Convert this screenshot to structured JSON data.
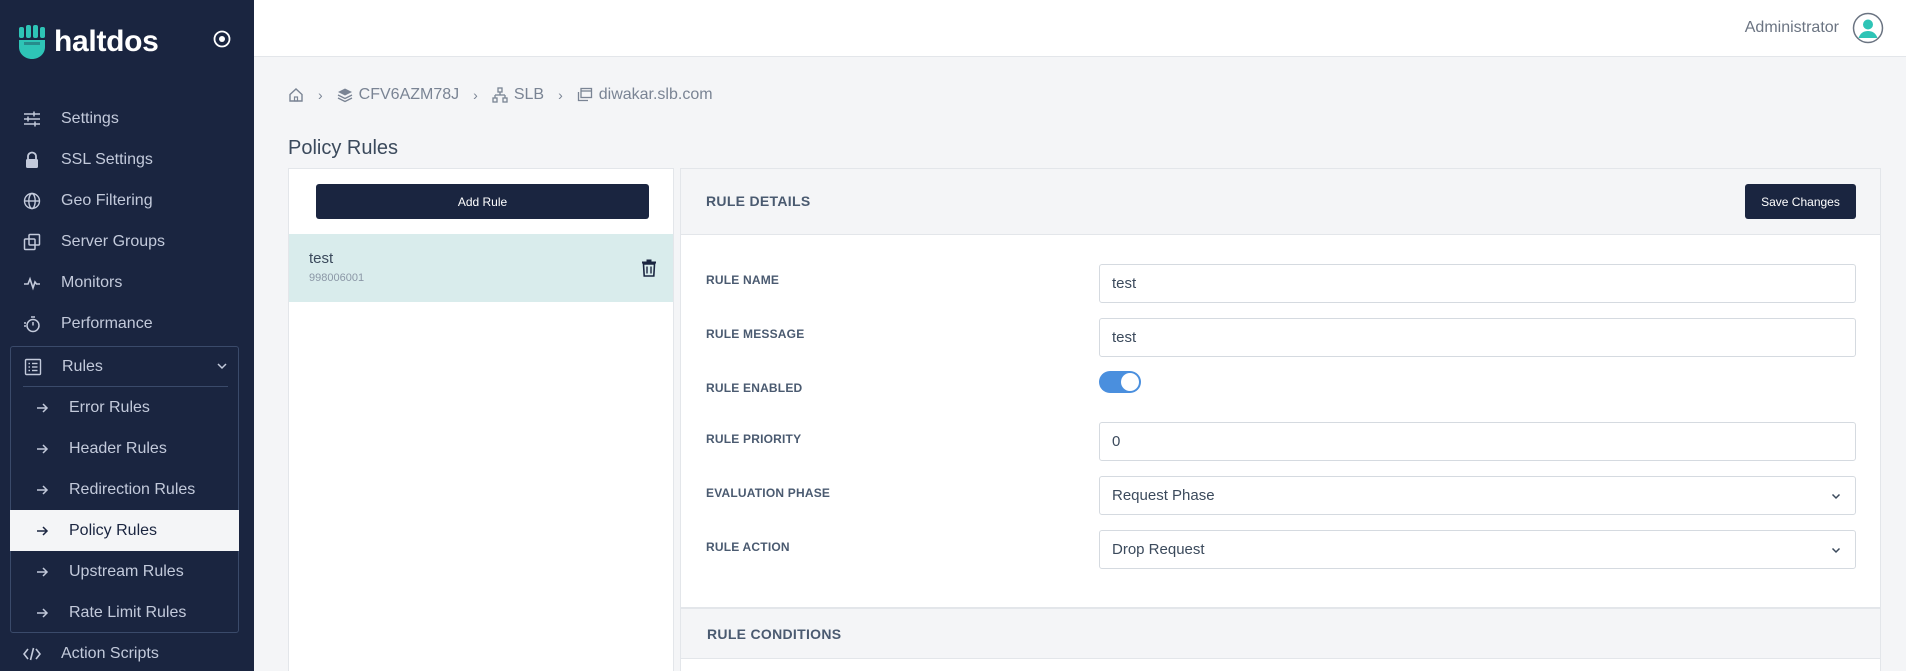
{
  "brand": {
    "name": "haltdos"
  },
  "sidebar": {
    "items": [
      {
        "label": "Settings",
        "icon": "sliders-icon"
      },
      {
        "label": "SSL Settings",
        "icon": "lock-icon"
      },
      {
        "label": "Geo Filtering",
        "icon": "globe-icon"
      },
      {
        "label": "Server Groups",
        "icon": "server-groups-icon"
      },
      {
        "label": "Monitors",
        "icon": "pulse-icon"
      },
      {
        "label": "Performance",
        "icon": "stopwatch-icon"
      }
    ],
    "rules": {
      "label": "Rules",
      "icon": "list-icon",
      "children": [
        {
          "label": "Error Rules"
        },
        {
          "label": "Header Rules"
        },
        {
          "label": "Redirection Rules"
        },
        {
          "label": "Policy Rules",
          "active": true
        },
        {
          "label": "Upstream Rules"
        },
        {
          "label": "Rate Limit Rules"
        }
      ]
    },
    "bottom": {
      "label": "Action Scripts",
      "icon": "code-icon"
    }
  },
  "header": {
    "user": "Administrator"
  },
  "breadcrumb": {
    "items": [
      {
        "label": "CFV6AZM78J",
        "icon": "layers-icon"
      },
      {
        "label": "SLB",
        "icon": "sitemap-icon"
      },
      {
        "label": "diwakar.slb.com",
        "icon": "window-icon"
      }
    ]
  },
  "page": {
    "title": "Policy Rules"
  },
  "rule_list": {
    "add_label": "Add Rule",
    "rules": [
      {
        "name": "test",
        "id": "998006001"
      }
    ]
  },
  "details": {
    "title": "RULE DETAILS",
    "save_label": "Save Changes",
    "fields": {
      "rule_name": {
        "label": "RULE NAME",
        "value": "test"
      },
      "rule_message": {
        "label": "RULE MESSAGE",
        "value": "test"
      },
      "rule_enabled": {
        "label": "RULE ENABLED",
        "value": true
      },
      "rule_priority": {
        "label": "RULE PRIORITY",
        "value": "0"
      },
      "evaluation_phase": {
        "label": "EVALUATION PHASE",
        "value": "Request Phase"
      },
      "rule_action": {
        "label": "RULE ACTION",
        "value": "Drop Request"
      }
    }
  },
  "conditions": {
    "title": "RULE CONDITIONS"
  },
  "colors": {
    "sidebar_bg": "#1a2540",
    "accent": "#4a8fde",
    "logo_teal": "#2ec4b6",
    "selected_row": "#d9ecec"
  }
}
